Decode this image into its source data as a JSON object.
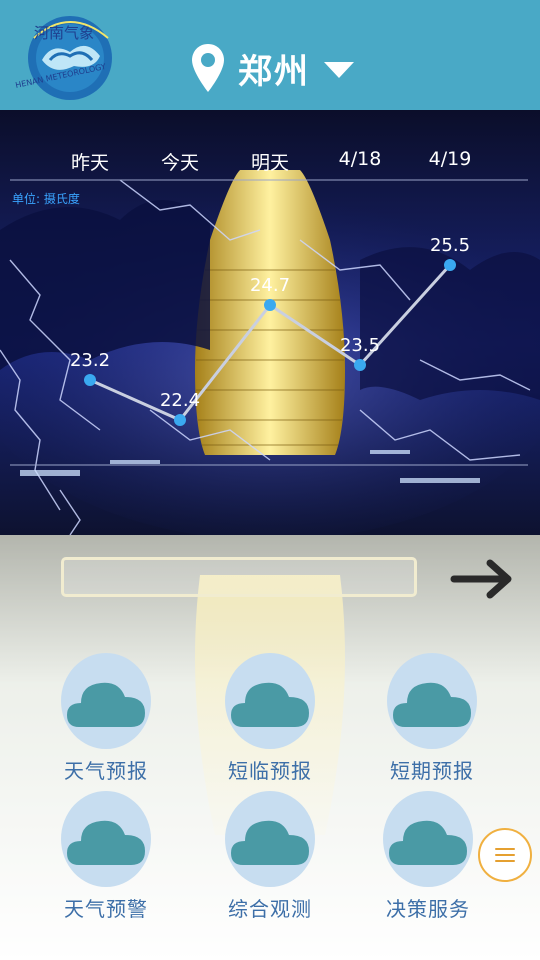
{
  "header": {
    "logo_name": "meteorological-bureau-logo",
    "logo_text_top": "河南气象",
    "logo_text_bottom": "HENAN METEOROLOGY",
    "city": "郑州",
    "pin_icon": "location-pin-icon",
    "dropdown_icon": "caret-down-icon"
  },
  "tabs": [
    {
      "label": "昨天"
    },
    {
      "label": "今天"
    },
    {
      "label": "明天"
    },
    {
      "label": "4/18"
    },
    {
      "label": "4/19"
    }
  ],
  "unit_label": "单位: 摄氏度",
  "chart_data": {
    "type": "line",
    "categories": [
      "昨天",
      "今天",
      "明天",
      "4/18",
      "4/19"
    ],
    "series": [
      {
        "values": [
          23.2,
          22.4,
          24.7,
          23.5,
          25.5
        ]
      }
    ],
    "y_labels": [
      "23.2",
      "22.4",
      "24.7",
      "23.5",
      "25.5"
    ],
    "ylim": [
      21.5,
      26.5
    ],
    "grid": false,
    "line_color": "#c9cfe0",
    "point_color": "#3aa9f0"
  },
  "search": {
    "value": "",
    "placeholder": ""
  },
  "go_icon": "arrow-right-icon",
  "tiles": [
    {
      "label": "天气预报",
      "icon": "cloud-icon"
    },
    {
      "label": "短临预报",
      "icon": "cloud-icon"
    },
    {
      "label": "短期预报",
      "icon": "cloud-icon"
    },
    {
      "label": "天气预警",
      "icon": "cloud-icon"
    },
    {
      "label": "综合观测",
      "icon": "cloud-icon"
    },
    {
      "label": "决策服务",
      "icon": "cloud-icon"
    }
  ],
  "menu_icon": "hamburger-menu-icon",
  "colors": {
    "header_bg": "#49a9c6",
    "tile_bubble": "#c7ddf0",
    "cloud": "#4a9aa5",
    "tile_label": "#3d6fa8",
    "fab_border": "#f0b040"
  }
}
